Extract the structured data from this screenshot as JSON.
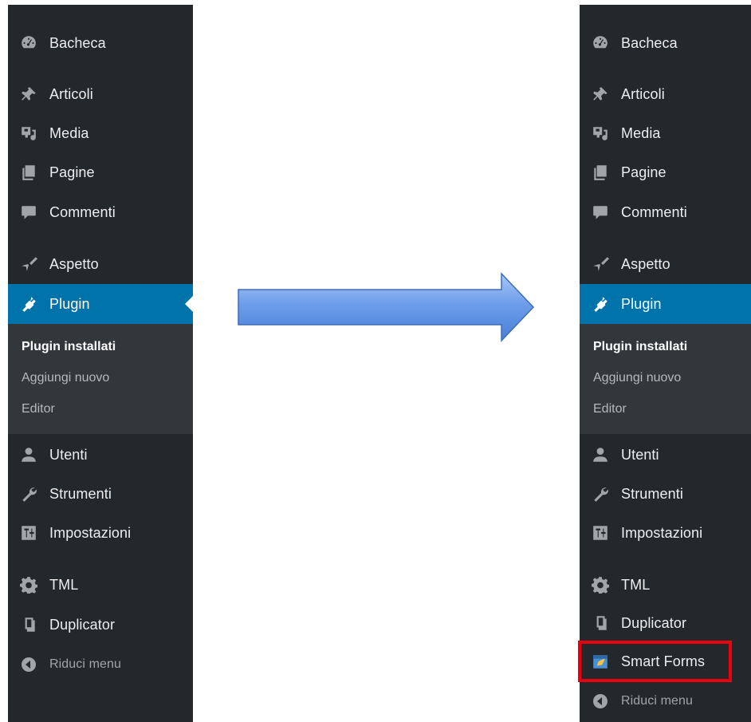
{
  "menu": {
    "items": [
      {
        "label": "Bacheca",
        "icon": "dashboard-icon"
      },
      {
        "label": "Articoli",
        "icon": "pin-icon"
      },
      {
        "label": "Media",
        "icon": "media-icon"
      },
      {
        "label": "Pagine",
        "icon": "pages-icon"
      },
      {
        "label": "Commenti",
        "icon": "comment-icon"
      },
      {
        "label": "Aspetto",
        "icon": "paintbrush-icon"
      },
      {
        "label": "Plugin",
        "icon": "plugin-icon"
      },
      {
        "label": "Utenti",
        "icon": "users-icon"
      },
      {
        "label": "Strumenti",
        "icon": "wrench-icon"
      },
      {
        "label": "Impostazioni",
        "icon": "settings-icon"
      },
      {
        "label": "TML",
        "icon": "gear-icon"
      },
      {
        "label": "Duplicator",
        "icon": "duplicator-icon"
      }
    ],
    "submenu": [
      {
        "label": "Plugin installati"
      },
      {
        "label": "Aggiungi nuovo"
      },
      {
        "label": "Editor"
      }
    ],
    "new_item": {
      "label": "Smart Forms",
      "icon": "smart-forms-icon"
    },
    "collapse_label": "Riduci menu"
  },
  "colors": {
    "menu_bg": "#23282d",
    "submenu_bg": "#32373c",
    "active": "#0073aa",
    "highlight": "#e8000e",
    "arrow_fill": "#6d9eeb"
  }
}
